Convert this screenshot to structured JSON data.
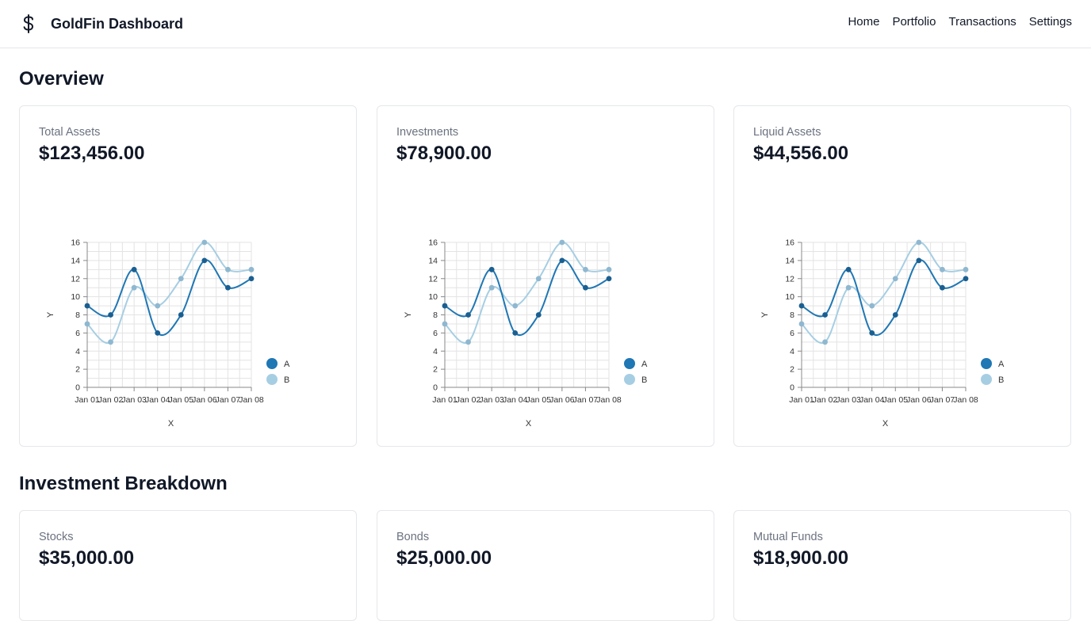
{
  "app": {
    "title": "GoldFin Dashboard",
    "icon": "dollar-sign-icon",
    "nav": [
      "Home",
      "Portfolio",
      "Transactions",
      "Settings"
    ]
  },
  "overview": {
    "title": "Overview",
    "cards": [
      {
        "label": "Total Assets",
        "value": "$123,456.00"
      },
      {
        "label": "Investments",
        "value": "$78,900.00"
      },
      {
        "label": "Liquid Assets",
        "value": "$44,556.00"
      }
    ]
  },
  "breakdown": {
    "title": "Investment Breakdown",
    "cards": [
      {
        "label": "Stocks",
        "value": "$35,000.00"
      },
      {
        "label": "Bonds",
        "value": "$25,000.00"
      },
      {
        "label": "Mutual Funds",
        "value": "$18,900.00"
      }
    ]
  },
  "colors": {
    "seriesA": "#1f77b4",
    "seriesB": "#a6cee3",
    "border": "#e5e7eb",
    "muted": "#6b7280"
  },
  "chart_data": [
    {
      "type": "line",
      "xlabel": "X",
      "ylabel": "Y",
      "ylim": [
        0,
        16
      ],
      "yticks": [
        0,
        2,
        4,
        6,
        8,
        10,
        12,
        14,
        16
      ],
      "grid": true,
      "legend_position": "bottom-right",
      "categories": [
        "Jan 01",
        "Jan 02",
        "Jan 03",
        "Jan 04",
        "Jan 05",
        "Jan 06",
        "Jan 07",
        "Jan 08"
      ],
      "series": [
        {
          "name": "A",
          "values": [
            9,
            8,
            13,
            6,
            8,
            14,
            11,
            12
          ]
        },
        {
          "name": "B",
          "values": [
            7,
            5,
            11,
            9,
            12,
            16,
            13,
            13
          ]
        }
      ]
    },
    {
      "type": "line",
      "xlabel": "X",
      "ylabel": "Y",
      "ylim": [
        0,
        16
      ],
      "yticks": [
        0,
        2,
        4,
        6,
        8,
        10,
        12,
        14,
        16
      ],
      "grid": true,
      "legend_position": "bottom-right",
      "categories": [
        "Jan 01",
        "Jan 02",
        "Jan 03",
        "Jan 04",
        "Jan 05",
        "Jan 06",
        "Jan 07",
        "Jan 08"
      ],
      "series": [
        {
          "name": "A",
          "values": [
            9,
            8,
            13,
            6,
            8,
            14,
            11,
            12
          ]
        },
        {
          "name": "B",
          "values": [
            7,
            5,
            11,
            9,
            12,
            16,
            13,
            13
          ]
        }
      ]
    },
    {
      "type": "line",
      "xlabel": "X",
      "ylabel": "Y",
      "ylim": [
        0,
        16
      ],
      "yticks": [
        0,
        2,
        4,
        6,
        8,
        10,
        12,
        14,
        16
      ],
      "grid": true,
      "legend_position": "bottom-right",
      "categories": [
        "Jan 01",
        "Jan 02",
        "Jan 03",
        "Jan 04",
        "Jan 05",
        "Jan 06",
        "Jan 07",
        "Jan 08"
      ],
      "series": [
        {
          "name": "A",
          "values": [
            9,
            8,
            13,
            6,
            8,
            14,
            11,
            12
          ]
        },
        {
          "name": "B",
          "values": [
            7,
            5,
            11,
            9,
            12,
            16,
            13,
            13
          ]
        }
      ]
    }
  ]
}
